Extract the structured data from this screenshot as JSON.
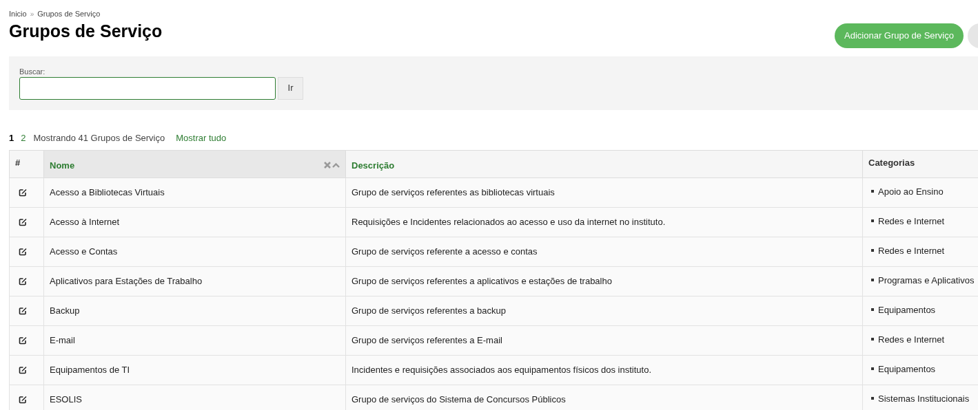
{
  "breadcrumb": [
    "Inicio",
    "Grupos de Serviço"
  ],
  "breadcrumb_separator": "»",
  "title": "Grupos de Serviço",
  "add_button": "Adicionar Grupo de Serviço",
  "search": {
    "label": "Buscar:",
    "button": "Ir"
  },
  "pagination": {
    "pages": [
      {
        "label": "1",
        "selected": true
      },
      {
        "label": "2",
        "selected": false
      }
    ],
    "summary": "Mostrando 41 Grupos de Serviço",
    "show_all": "Mostrar tudo"
  },
  "table": {
    "columns": [
      {
        "label": "#",
        "sortable": false,
        "sorted": false
      },
      {
        "label": "Nome",
        "sortable": true,
        "sorted": true
      },
      {
        "label": "Descrição",
        "sortable": true,
        "sorted": false
      },
      {
        "label": "Categorias",
        "sortable": false,
        "sorted": false
      }
    ],
    "rows": [
      {
        "name": "Acesso a Bibliotecas Virtuais",
        "description": "Grupo de serviços referentes as bibliotecas virtuais",
        "categories": [
          "Apoio ao Ensino"
        ]
      },
      {
        "name": "Acesso à Internet",
        "description": "Requisições e Incidentes relacionados ao acesso e uso da internet no instituto.",
        "categories": [
          "Redes e Internet"
        ]
      },
      {
        "name": "Acesso e Contas",
        "description": "Grupo de serviços referente a acesso e contas",
        "categories": [
          "Redes e Internet"
        ]
      },
      {
        "name": "Aplicativos para Estações de Trabalho",
        "description": "Grupo de serviços referentes a aplicativos e estações de trabalho",
        "categories": [
          "Programas e Aplicativos"
        ]
      },
      {
        "name": "Backup",
        "description": "Grupo de serviços referentes a backup",
        "categories": [
          "Equipamentos"
        ]
      },
      {
        "name": "E-mail",
        "description": "Grupo de serviços referentes a E-mail",
        "categories": [
          "Redes e Internet"
        ]
      },
      {
        "name": "Equipamentos de TI",
        "description": "Incidentes e requisições associados aos equipamentos físicos dos instituto.",
        "categories": [
          "Equipamentos"
        ]
      },
      {
        "name": "ESOLIS",
        "description": "Grupo de serviços do Sistema de Concursos Públicos",
        "categories": [
          "Sistemas Institucionais"
        ]
      }
    ]
  }
}
